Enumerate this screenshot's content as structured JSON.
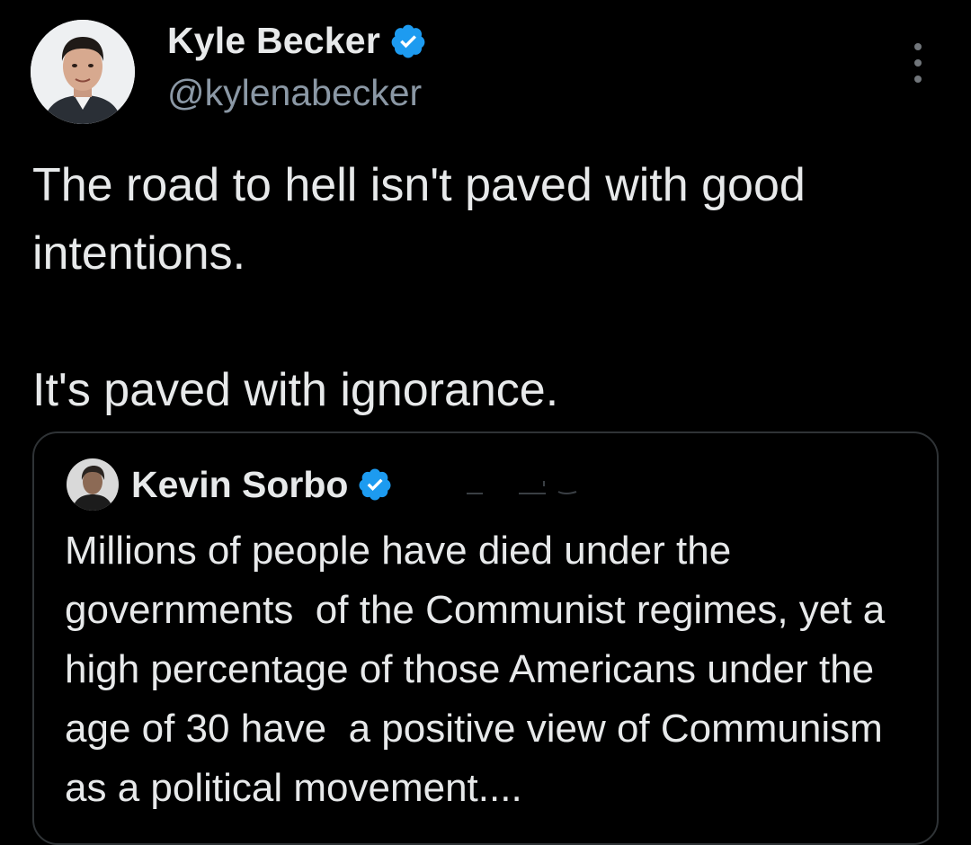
{
  "tweet": {
    "author": {
      "display_name": "Kyle Becker",
      "handle": "@kylenabecker",
      "verified": true,
      "verified_icon": "verified-badge-icon",
      "avatar_icon": "profile-photo"
    },
    "more_icon": "more-options-icon",
    "text": "The road to hell isn't paved with good intentions.\n\nIt's paved with ignorance.",
    "quoted": {
      "author": {
        "display_name": "Kevin Sorbo",
        "verified": true,
        "avatar_icon": "profile-photo"
      },
      "text": "Millions of people have died under the governments  of the Communist regimes, yet a high percentage of those Americans under the age of 30 have  a positive view of Communism as a political movement...."
    }
  },
  "colors": {
    "background": "#000000",
    "primary_text": "#e7e9ea",
    "secondary_text": "#8b98a5",
    "verified_blue": "#1d9bf0",
    "border": "#2f3336"
  }
}
